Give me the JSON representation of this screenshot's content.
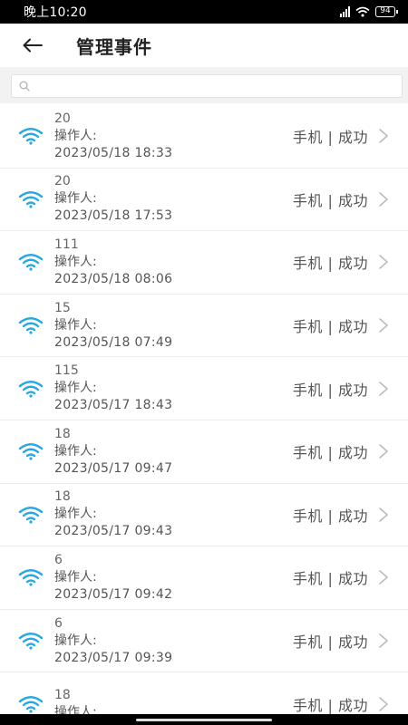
{
  "status_bar": {
    "time": "晚上10:20",
    "battery": "94"
  },
  "header": {
    "title": "管理事件"
  },
  "search": {
    "placeholder": "",
    "value": ""
  },
  "colors": {
    "wifi_icon": "#29a8e0",
    "chevron": "#bbbbbb"
  },
  "events": [
    {
      "name": "20",
      "operator_label": "操作人:",
      "datetime": "2023/05/18 18:33",
      "status": "手机 | 成功"
    },
    {
      "name": "20",
      "operator_label": "操作人:",
      "datetime": "2023/05/18 17:53",
      "status": "手机 | 成功"
    },
    {
      "name": "111",
      "operator_label": "操作人:",
      "datetime": "2023/05/18 08:06",
      "status": "手机 | 成功"
    },
    {
      "name": "15",
      "operator_label": "操作人:",
      "datetime": "2023/05/18 07:49",
      "status": "手机 | 成功"
    },
    {
      "name": "115",
      "operator_label": "操作人:",
      "datetime": "2023/05/17 18:43",
      "status": "手机 | 成功"
    },
    {
      "name": "18",
      "operator_label": "操作人:",
      "datetime": "2023/05/17 09:47",
      "status": "手机 | 成功"
    },
    {
      "name": "18",
      "operator_label": "操作人:",
      "datetime": "2023/05/17 09:43",
      "status": "手机 | 成功"
    },
    {
      "name": "6",
      "operator_label": "操作人:",
      "datetime": "2023/05/17 09:42",
      "status": "手机 | 成功"
    },
    {
      "name": "6",
      "operator_label": "操作人:",
      "datetime": "2023/05/17 09:39",
      "status": "手机 | 成功"
    },
    {
      "name": "18",
      "operator_label": "操作人:",
      "datetime": "",
      "status": "手机 | 成功"
    }
  ]
}
